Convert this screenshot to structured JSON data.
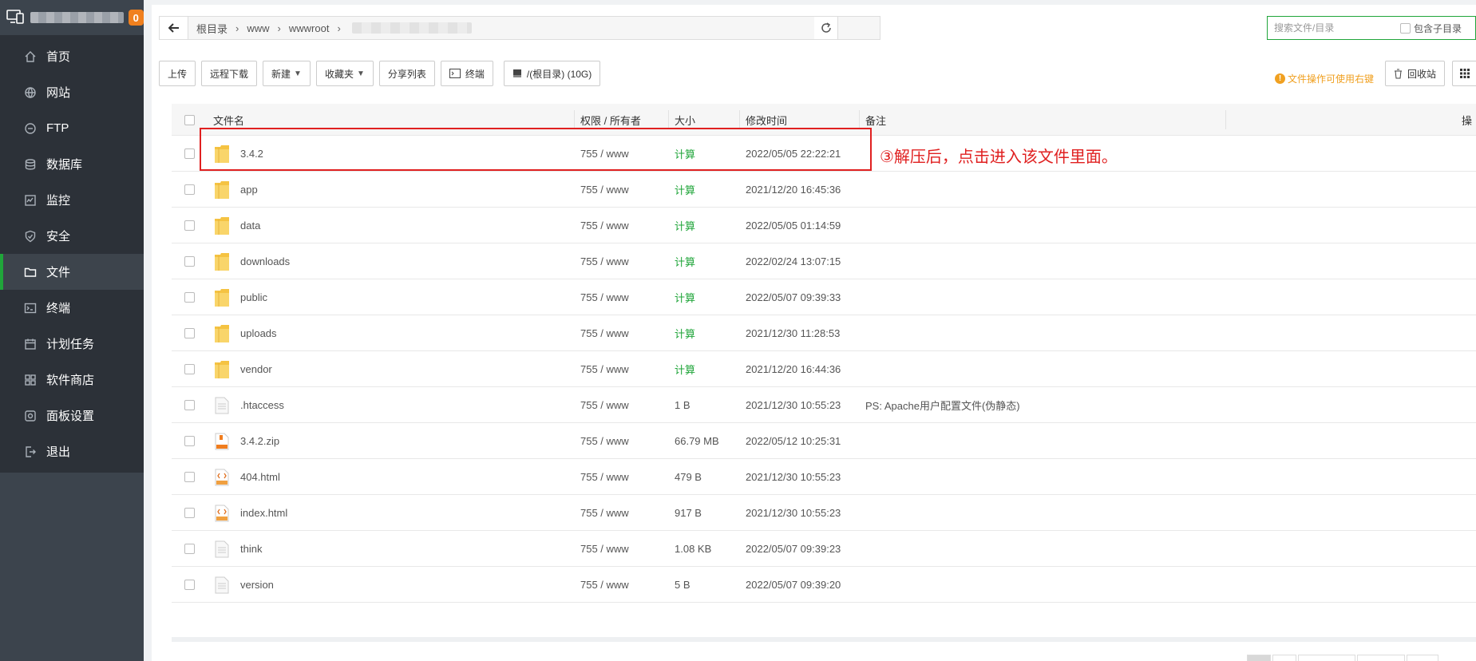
{
  "sidebar": {
    "badge": "0",
    "items": [
      {
        "label": "首页",
        "icon": "home-icon"
      },
      {
        "label": "网站",
        "icon": "globe-icon"
      },
      {
        "label": "FTP",
        "icon": "ftp-icon"
      },
      {
        "label": "数据库",
        "icon": "database-icon"
      },
      {
        "label": "监控",
        "icon": "monitor-icon"
      },
      {
        "label": "安全",
        "icon": "shield-icon"
      },
      {
        "label": "文件",
        "icon": "folder-icon"
      },
      {
        "label": "终端",
        "icon": "terminal-icon"
      },
      {
        "label": "计划任务",
        "icon": "calendar-icon"
      },
      {
        "label": "软件商店",
        "icon": "apps-icon"
      },
      {
        "label": "面板设置",
        "icon": "settings-icon"
      },
      {
        "label": "退出",
        "icon": "logout-icon"
      }
    ],
    "active_index": 6
  },
  "path": {
    "crumbs": [
      "根目录",
      "www",
      "wwwroot"
    ]
  },
  "search": {
    "placeholder": "搜索文件/目录",
    "include_sub_label": "包含子目录"
  },
  "toolbar": {
    "upload": "上传",
    "remote_download": "远程下载",
    "new": "新建",
    "favorites": "收藏夹",
    "share_list": "分享列表",
    "terminal": "终端",
    "disk": "/(根目录) (10G)",
    "tip": "文件操作可使用右键",
    "recycle": "回收站"
  },
  "table": {
    "headers": {
      "name": "文件名",
      "perm": "权限 / 所有者",
      "size": "大小",
      "mtime": "修改时间",
      "note": "备注",
      "ops": "操"
    },
    "rows": [
      {
        "type": "folder",
        "name": "3.4.2",
        "perm": "755 / www",
        "size": "计算",
        "mtime": "2022/05/05 22:22:21",
        "note": ""
      },
      {
        "type": "folder",
        "name": "app",
        "perm": "755 / www",
        "size": "计算",
        "mtime": "2021/12/20 16:45:36",
        "note": ""
      },
      {
        "type": "folder",
        "name": "data",
        "perm": "755 / www",
        "size": "计算",
        "mtime": "2022/05/05 01:14:59",
        "note": ""
      },
      {
        "type": "folder",
        "name": "downloads",
        "perm": "755 / www",
        "size": "计算",
        "mtime": "2022/02/24 13:07:15",
        "note": ""
      },
      {
        "type": "folder",
        "name": "public",
        "perm": "755 / www",
        "size": "计算",
        "mtime": "2022/05/07 09:39:33",
        "note": ""
      },
      {
        "type": "folder",
        "name": "uploads",
        "perm": "755 / www",
        "size": "计算",
        "mtime": "2021/12/30 11:28:53",
        "note": ""
      },
      {
        "type": "folder",
        "name": "vendor",
        "perm": "755 / www",
        "size": "计算",
        "mtime": "2021/12/20 16:44:36",
        "note": ""
      },
      {
        "type": "file",
        "name": ".htaccess",
        "perm": "755 / www",
        "size": "1 B",
        "mtime": "2021/12/30 10:55:23",
        "note": "PS: Apache用户配置文件(伪静态)"
      },
      {
        "type": "zip",
        "name": "3.4.2.zip",
        "perm": "755 / www",
        "size": "66.79 MB",
        "mtime": "2022/05/12 10:25:31",
        "note": ""
      },
      {
        "type": "html",
        "name": "404.html",
        "perm": "755 / www",
        "size": "479 B",
        "mtime": "2021/12/30 10:55:23",
        "note": ""
      },
      {
        "type": "html",
        "name": "index.html",
        "perm": "755 / www",
        "size": "917 B",
        "mtime": "2021/12/30 10:55:23",
        "note": ""
      },
      {
        "type": "file",
        "name": "think",
        "perm": "755 / www",
        "size": "1.08 KB",
        "mtime": "2022/05/07 09:39:23",
        "note": ""
      },
      {
        "type": "file",
        "name": "version",
        "perm": "755 / www",
        "size": "5 B",
        "mtime": "2022/05/07 09:39:20",
        "note": ""
      }
    ]
  },
  "annotation": {
    "text": "③解压后，点击进入该文件里面。",
    "color": "#e02020"
  },
  "colors": {
    "accent": "#20a53a",
    "sidebar": "#2c3138",
    "folder": "#f5c342",
    "warning": "#f0a020"
  }
}
